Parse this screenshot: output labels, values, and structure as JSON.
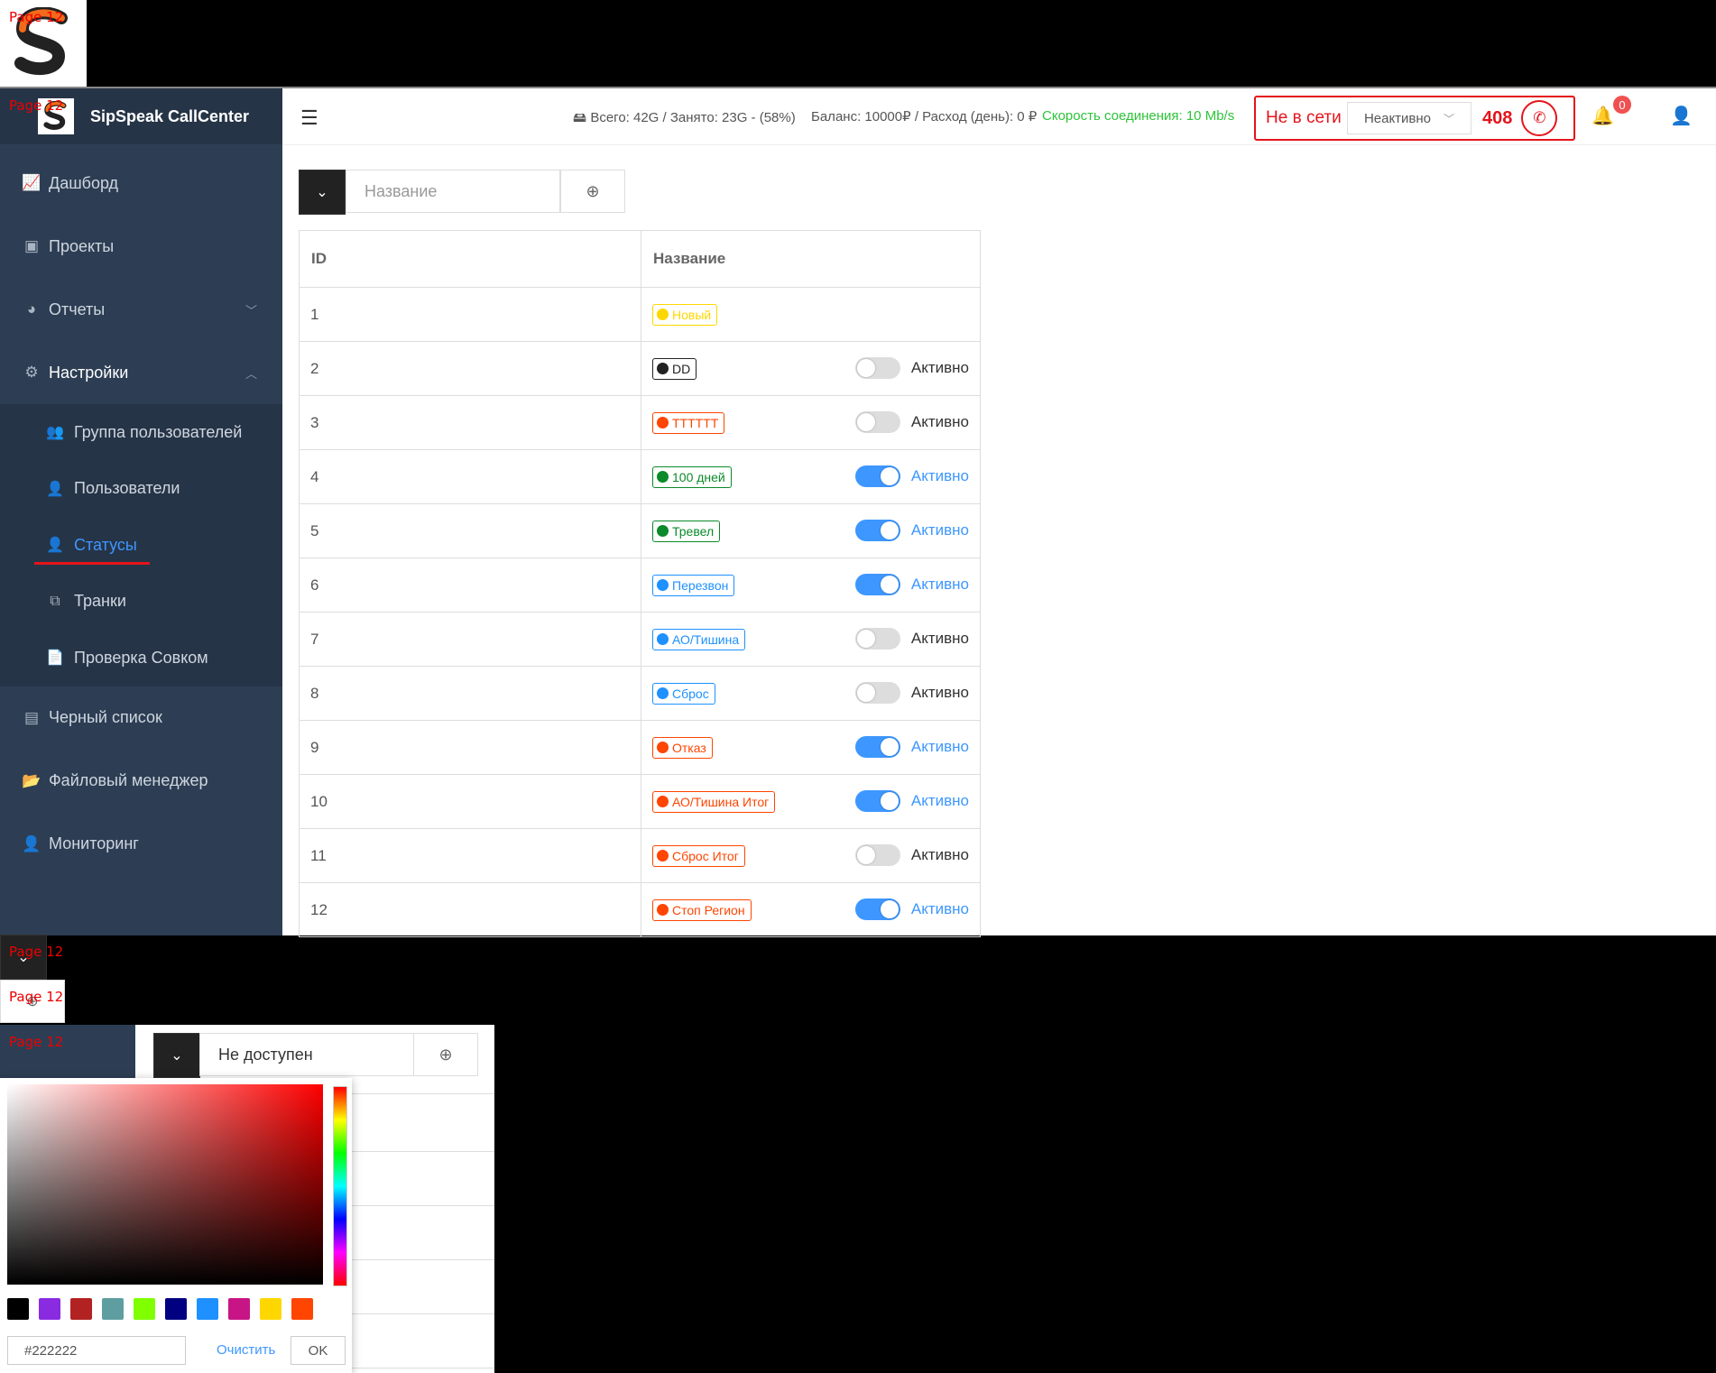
{
  "page_tag": "Page 12",
  "brand": {
    "name": "SipSpeak CallCenter"
  },
  "sidebar": {
    "items": [
      {
        "label": "Дашборд",
        "icon": "chart-line-icon"
      },
      {
        "label": "Проекты",
        "icon": "robot-icon"
      },
      {
        "label": "Отчеты",
        "icon": "pie-chart-icon"
      },
      {
        "label": "Настройки",
        "icon": "gear-icon"
      },
      {
        "label": "Черный список",
        "icon": "contact-book-icon"
      },
      {
        "label": "Файловый менеджер",
        "icon": "folder-open-icon"
      },
      {
        "label": "Мониторинг",
        "icon": "user-check-icon"
      }
    ],
    "submenu": [
      {
        "label": "Группа пользователей",
        "icon": "users-group-icon"
      },
      {
        "label": "Пользователи",
        "icon": "user-icon"
      },
      {
        "label": "Статусы",
        "icon": "user-edit-icon"
      },
      {
        "label": "Транки",
        "icon": "network-icon"
      },
      {
        "label": "Проверка Совком",
        "icon": "file-export-icon"
      }
    ]
  },
  "header": {
    "storage": "Всего: 42G / Занято: 23G - (58%)",
    "balance": "Баланс: 10000₽ / Расход (день): 0 ₽",
    "speed": "Скорость соединения: 10 Mb/s",
    "offline": "Не в сети",
    "state_select": "Неактивно",
    "extension": "408",
    "notifications": "0"
  },
  "toolbar": {
    "name_placeholder": "Название"
  },
  "table": {
    "headers": [
      "ID",
      "Название"
    ],
    "toggle_label": "Активно",
    "rows": [
      {
        "id": "1",
        "name": "Новый",
        "color": "#ffd700",
        "toggle": null
      },
      {
        "id": "2",
        "name": "DD",
        "color": "#222222",
        "toggle": false
      },
      {
        "id": "3",
        "name": "TTTTTT",
        "color": "#ff4500",
        "toggle": false
      },
      {
        "id": "4",
        "name": "100 дней",
        "color": "#0a8a2a",
        "toggle": true
      },
      {
        "id": "5",
        "name": "Тревел",
        "color": "#0a8a2a",
        "toggle": true
      },
      {
        "id": "6",
        "name": "Перезвон",
        "color": "#1e90ff",
        "toggle": true
      },
      {
        "id": "7",
        "name": "АО/Тишина",
        "color": "#1e90ff",
        "toggle": false
      },
      {
        "id": "8",
        "name": "Сброс",
        "color": "#1e90ff",
        "toggle": false
      },
      {
        "id": "9",
        "name": "Отказ",
        "color": "#ff4500",
        "toggle": true
      },
      {
        "id": "10",
        "name": "АО/Тишина Итог",
        "color": "#ff4500",
        "toggle": true
      },
      {
        "id": "11",
        "name": "Сброс Итог",
        "color": "#ff4500",
        "toggle": false
      },
      {
        "id": "12",
        "name": "Стоп Регион",
        "color": "#ff4500",
        "toggle": true
      }
    ]
  },
  "lower": {
    "name_value": "Не доступен",
    "picker": {
      "swatches": [
        "#000000",
        "#8a2be2",
        "#b22222",
        "#5f9ea0",
        "#7fff00",
        "#000080",
        "#1e90ff",
        "#c71585",
        "#ffd700",
        "#ff4500"
      ],
      "hex_value": "#222222",
      "clear_label": "Очистить",
      "ok_label": "OK"
    }
  }
}
